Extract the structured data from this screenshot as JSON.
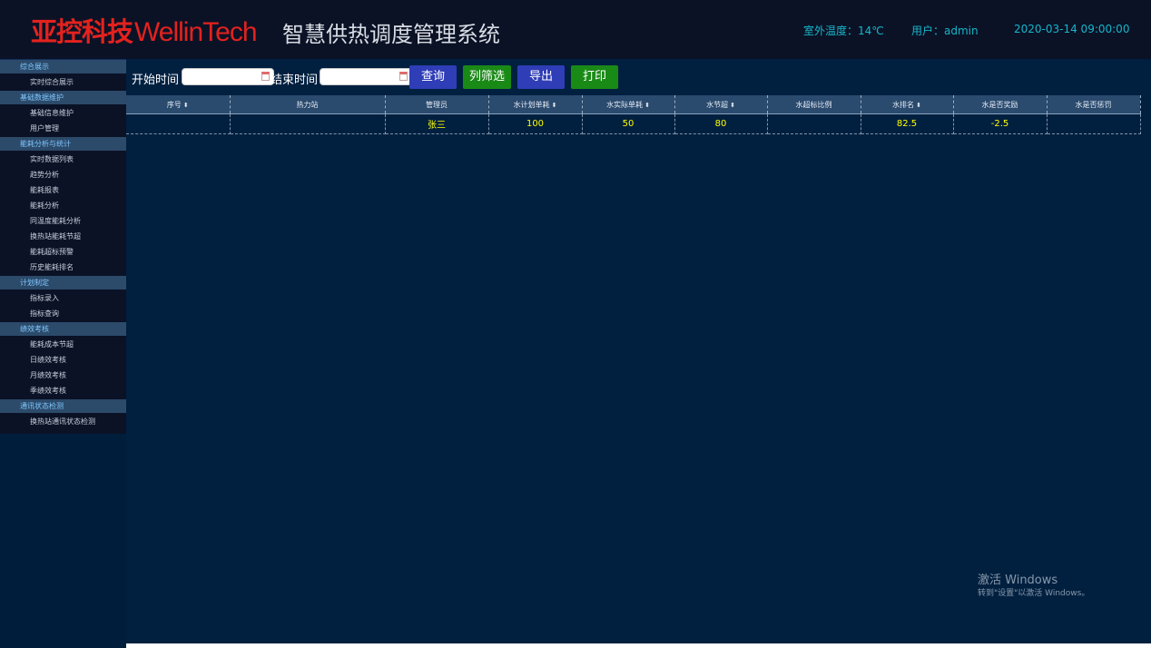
{
  "header": {
    "logo_cn": "亚控科技",
    "logo_en": "WellinTech",
    "system_title": "智慧供热调度管理系统",
    "outdoor_temp": "室外温度：14℃",
    "user": "用户：admin",
    "datetime": "2020-03-14 09:00:00"
  },
  "sidebar": {
    "groups": [
      {
        "label": "综合展示",
        "items": [
          "实时综合展示"
        ]
      },
      {
        "label": "基础数据维护",
        "items": [
          "基础信息维护",
          "用户管理"
        ]
      },
      {
        "label": "能耗分析与统计",
        "items": [
          "实时数据列表",
          "趋势分析",
          "能耗报表",
          "能耗分析",
          "同温度能耗分析",
          "换热站能耗节超",
          "能耗超标预警",
          "历史能耗排名"
        ]
      },
      {
        "label": "计划制定",
        "items": [
          "指标录入",
          "指标查询"
        ]
      },
      {
        "label": "绩效考核",
        "items": [
          "能耗成本节超",
          "日绩效考核",
          "月绩效考核",
          "季绩效考核"
        ]
      },
      {
        "label": "通讯状态检测",
        "items": [
          "换热站通讯状态检测"
        ]
      }
    ]
  },
  "toolbar": {
    "start_label": "开始时间",
    "end_label": "结束时间",
    "start_value": "",
    "end_value": "",
    "query": "查询",
    "column_filter": "列筛选",
    "export": "导出",
    "print": "打印"
  },
  "table": {
    "columns": [
      {
        "label": "序号",
        "sortable": true
      },
      {
        "label": "热力站",
        "sortable": false
      },
      {
        "label": "管理员",
        "sortable": false
      },
      {
        "label": "水计划单耗",
        "sortable": true
      },
      {
        "label": "水实际单耗",
        "sortable": true
      },
      {
        "label": "水节超",
        "sortable": true
      },
      {
        "label": "水超标比例",
        "sortable": false
      },
      {
        "label": "水排名",
        "sortable": true
      },
      {
        "label": "水是否奖励",
        "sortable": false
      },
      {
        "label": "水是否惩罚",
        "sortable": false
      }
    ],
    "rows": [
      [
        "",
        "",
        "张三",
        "100",
        "50",
        "80",
        "",
        "82.5",
        "-2.5",
        ""
      ]
    ]
  },
  "watermark": {
    "line1": "激活 Windows",
    "line2": "转到\"设置\"以激活 Windows。"
  },
  "colors": {
    "header_bg": "#0b1226",
    "main_bg": "#012040",
    "logo_red": "#e3221e",
    "info_cyan": "#17b6c9",
    "cell_yellow": "#ffff00",
    "group_bg": "#2c4a6a",
    "button_blue": "#2f3db7",
    "button_green": "#1a8a17"
  }
}
